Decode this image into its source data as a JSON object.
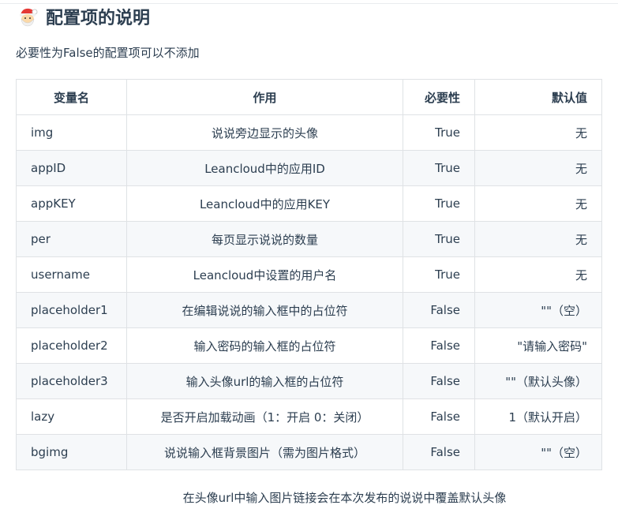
{
  "heading": {
    "title": "配置项的说明",
    "icon": "santa-emoji"
  },
  "note": "必要性为False的配置项可以不添加",
  "table": {
    "headers": [
      "变量名",
      "作用",
      "必要性",
      "默认值"
    ],
    "rows": [
      [
        "img",
        "说说旁边显示的头像",
        "True",
        "无"
      ],
      [
        "appID",
        "Leancloud中的应用ID",
        "True",
        "无"
      ],
      [
        "appKEY",
        "Leancloud中的应用KEY",
        "True",
        "无"
      ],
      [
        "per",
        "每页显示说说的数量",
        "True",
        "无"
      ],
      [
        "username",
        "Leancloud中设置的用户名",
        "True",
        "无"
      ],
      [
        "placeholder1",
        "在编辑说说的输入框中的占位符",
        "False",
        "\"\"（空）"
      ],
      [
        "placeholder2",
        "输入密码的输入框的占位符",
        "False",
        "\"请输入密码\""
      ],
      [
        "placeholder3",
        "输入头像url的输入框的占位符",
        "False",
        "\"\"（默认头像）"
      ],
      [
        "lazy",
        "是否开启加载动画（1：开启 0：关闭）",
        "False",
        "1（默认开启）"
      ],
      [
        "bgimg",
        "说说输入框背景图片（需为图片格式）",
        "False",
        "\"\"（空）"
      ]
    ]
  },
  "footer": "在头像url中输入图片链接会在本次发布的说说中覆盖默认头像"
}
